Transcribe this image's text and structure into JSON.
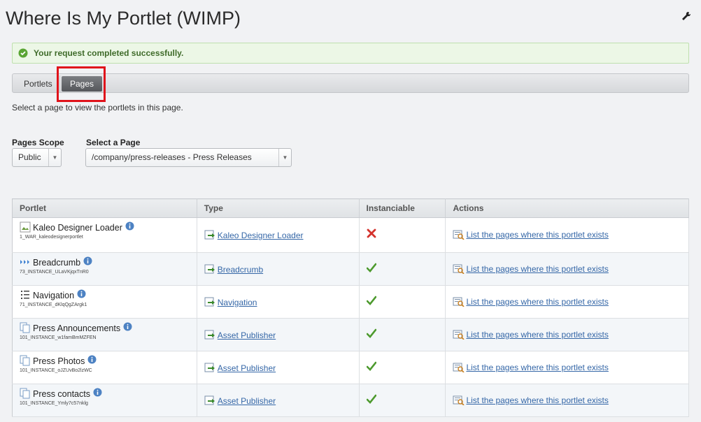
{
  "page": {
    "title": "Where Is My Portlet (WIMP)",
    "success_message": "Your request completed successfully.",
    "instructions": "Select a page to view the portlets in this page."
  },
  "tabs": [
    {
      "label": "Portlets",
      "active": false
    },
    {
      "label": "Pages",
      "active": true
    }
  ],
  "filters": {
    "scope_label": "Pages Scope",
    "scope_value": "Public",
    "page_label": "Select a Page",
    "page_value": "/company/press-releases - Press Releases"
  },
  "table": {
    "headers": [
      "Portlet",
      "Type",
      "Instanciable",
      "Actions"
    ],
    "rows": [
      {
        "name": "Kaleo Designer Loader",
        "id": "1_WAR_kaleodesignerportlet",
        "icon": "broken-image-icon",
        "type": "Kaleo Designer Loader",
        "instanciable": false,
        "action": "List the pages where this portlet exists"
      },
      {
        "name": "Breadcrumb",
        "id": "73_INSTANCE_ULaVKjqxTnR0",
        "icon": "breadcrumb-icon",
        "type": "Breadcrumb",
        "instanciable": true,
        "action": "List the pages where this portlet exists"
      },
      {
        "name": "Navigation",
        "id": "71_INSTANCE_dKlqQgZArgk1",
        "icon": "navigation-icon",
        "type": "Navigation",
        "instanciable": true,
        "action": "List the pages where this portlet exists"
      },
      {
        "name": "Press Announcements",
        "id": "101_INSTANCE_w1famBmMZFEN",
        "icon": "pages-icon",
        "type": "Asset Publisher",
        "instanciable": true,
        "action": "List the pages where this portlet exists"
      },
      {
        "name": "Press Photos",
        "id": "101_INSTANCE_oJZUvBo2lzWC",
        "icon": "pages-icon",
        "type": "Asset Publisher",
        "instanciable": true,
        "action": "List the pages where this portlet exists"
      },
      {
        "name": "Press contacts",
        "id": "101_INSTANCE_Ymly7c57nklg",
        "icon": "pages-icon",
        "type": "Asset Publisher",
        "instanciable": true,
        "action": "List the pages where this portlet exists"
      }
    ]
  },
  "colors": {
    "highlight": "#e0131b",
    "link": "#3567a7",
    "success_bg": "#ecf7e6"
  }
}
